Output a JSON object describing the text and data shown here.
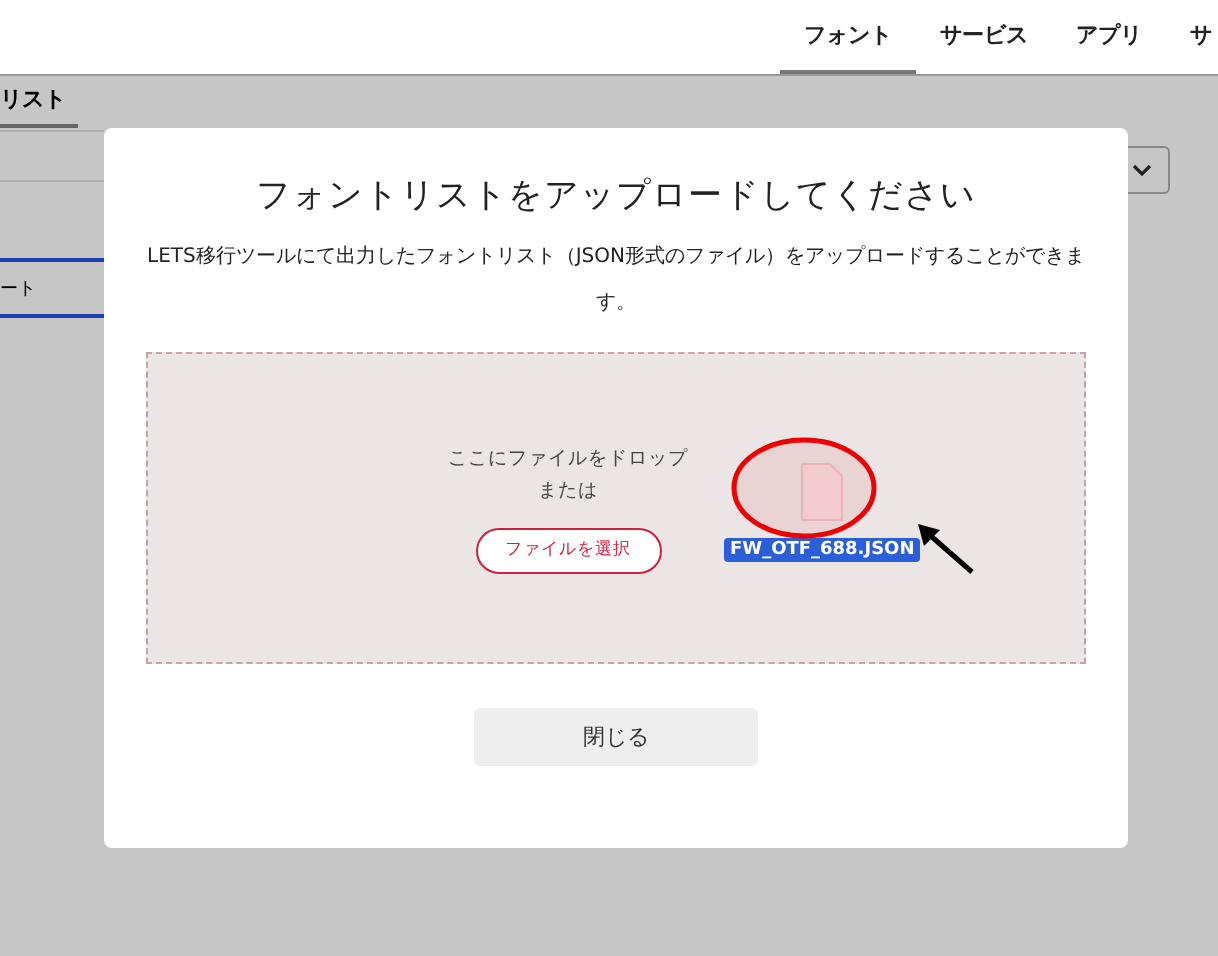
{
  "nav": {
    "items": [
      {
        "label": "フォント",
        "selected": true
      },
      {
        "label": "サービス",
        "selected": false
      },
      {
        "label": "アプリ",
        "selected": false
      },
      {
        "label": "サ",
        "selected": false
      }
    ]
  },
  "sub_tab": {
    "label": "リスト",
    "selected": true
  },
  "side_list": [
    {
      "selected": false
    },
    {
      "selected": false
    },
    {
      "label": "ート",
      "selected": true
    }
  ],
  "dialog": {
    "title": "フォントリストをアップロードしてください",
    "description": "LETS移行ツールにて出力したフォントリスト（JSON形式のファイル）をアップロードすることができます。",
    "drop_zone": {
      "prompt": "ここにファイルをドロップ",
      "or": "または",
      "button": "ファイルを選択",
      "dragged_file": "FW_OTF_688.JSON"
    },
    "close_button": "閉じる"
  }
}
